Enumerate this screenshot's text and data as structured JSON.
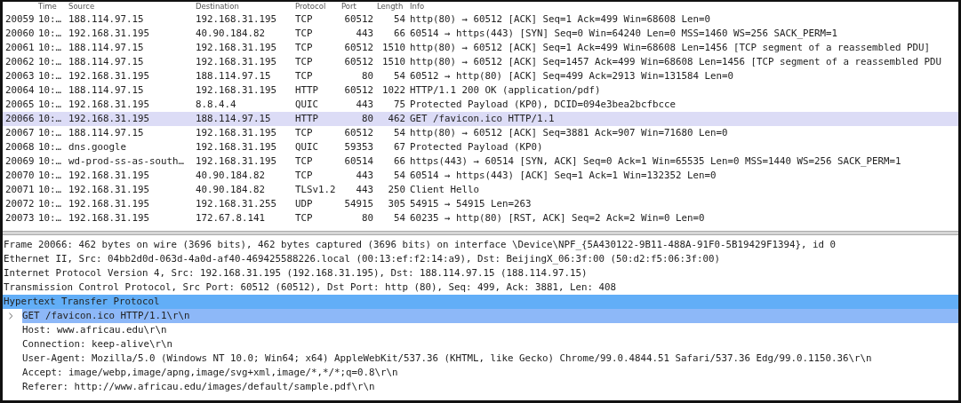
{
  "packet_list": {
    "columns": [
      "Time",
      "Source",
      "Destination",
      "Protocol",
      "Port",
      "Length",
      "Info"
    ],
    "rows": [
      {
        "no": "20059",
        "time": "10:…",
        "source": "188.114.97.15",
        "destination": "192.168.31.195",
        "protocol": "TCP",
        "port": "60512",
        "length": "54",
        "info": "http(80) → 60512 [ACK] Seq=1 Ack=499 Win=68608 Len=0",
        "selected": false
      },
      {
        "no": "20060",
        "time": "10:…",
        "source": "192.168.31.195",
        "destination": "40.90.184.82",
        "protocol": "TCP",
        "port": "443",
        "length": "66",
        "info": "60514 → https(443) [SYN] Seq=0 Win=64240 Len=0 MSS=1460 WS=256 SACK_PERM=1",
        "selected": false
      },
      {
        "no": "20061",
        "time": "10:…",
        "source": "188.114.97.15",
        "destination": "192.168.31.195",
        "protocol": "TCP",
        "port": "60512",
        "length": "1510",
        "info": "http(80) → 60512 [ACK] Seq=1 Ack=499 Win=68608 Len=1456 [TCP segment of a reassembled PDU]",
        "selected": false
      },
      {
        "no": "20062",
        "time": "10:…",
        "source": "188.114.97.15",
        "destination": "192.168.31.195",
        "protocol": "TCP",
        "port": "60512",
        "length": "1510",
        "info": "http(80) → 60512 [ACK] Seq=1457 Ack=499 Win=68608 Len=1456 [TCP segment of a reassembled PDU",
        "selected": false
      },
      {
        "no": "20063",
        "time": "10:…",
        "source": "192.168.31.195",
        "destination": "188.114.97.15",
        "protocol": "TCP",
        "port": "80",
        "length": "54",
        "info": "60512 → http(80) [ACK] Seq=499 Ack=2913 Win=131584 Len=0",
        "selected": false
      },
      {
        "no": "20064",
        "time": "10:…",
        "source": "188.114.97.15",
        "destination": "192.168.31.195",
        "protocol": "HTTP",
        "port": "60512",
        "length": "1022",
        "info": "HTTP/1.1 200 OK  (application/pdf)",
        "selected": false
      },
      {
        "no": "20065",
        "time": "10:…",
        "source": "192.168.31.195",
        "destination": "8.8.4.4",
        "protocol": "QUIC",
        "port": "443",
        "length": "75",
        "info": "Protected Payload (KP0), DCID=094e3bea2bcfbcce",
        "selected": false
      },
      {
        "no": "20066",
        "time": "10:…",
        "source": "192.168.31.195",
        "destination": "188.114.97.15",
        "protocol": "HTTP",
        "port": "80",
        "length": "462",
        "info": "GET /favicon.ico HTTP/1.1",
        "selected": true
      },
      {
        "no": "20067",
        "time": "10:…",
        "source": "188.114.97.15",
        "destination": "192.168.31.195",
        "protocol": "TCP",
        "port": "60512",
        "length": "54",
        "info": "http(80) → 60512 [ACK] Seq=3881 Ack=907 Win=71680 Len=0",
        "selected": false
      },
      {
        "no": "20068",
        "time": "10:…",
        "source": "dns.google",
        "destination": "192.168.31.195",
        "protocol": "QUIC",
        "port": "59353",
        "length": "67",
        "info": "Protected Payload (KP0)",
        "selected": false
      },
      {
        "no": "20069",
        "time": "10:…",
        "source": "wd-prod-ss-as-south…",
        "destination": "192.168.31.195",
        "protocol": "TCP",
        "port": "60514",
        "length": "66",
        "info": "https(443) → 60514 [SYN, ACK] Seq=0 Ack=1 Win=65535 Len=0 MSS=1440 WS=256 SACK_PERM=1",
        "selected": false
      },
      {
        "no": "20070",
        "time": "10:…",
        "source": "192.168.31.195",
        "destination": "40.90.184.82",
        "protocol": "TCP",
        "port": "443",
        "length": "54",
        "info": "60514 → https(443) [ACK] Seq=1 Ack=1 Win=132352 Len=0",
        "selected": false
      },
      {
        "no": "20071",
        "time": "10:…",
        "source": "192.168.31.195",
        "destination": "40.90.184.82",
        "protocol": "TLSv1.2",
        "port": "443",
        "length": "250",
        "info": "Client Hello",
        "selected": false
      },
      {
        "no": "20072",
        "time": "10:…",
        "source": "192.168.31.195",
        "destination": "192.168.31.255",
        "protocol": "UDP",
        "port": "54915",
        "length": "305",
        "info": "54915 → 54915 Len=263",
        "selected": false
      },
      {
        "no": "20073",
        "time": "10:…",
        "source": "192.168.31.195",
        "destination": "172.67.8.141",
        "protocol": "TCP",
        "port": "80",
        "length": "54",
        "info": "60235 → http(80) [RST, ACK] Seq=2 Ack=2 Win=0 Len=0",
        "selected": false
      }
    ]
  },
  "details": [
    {
      "text": "Frame 20066: 462 bytes on wire (3696 bits), 462 bytes captured (3696 bits) on interface \\Device\\NPF_{5A430122-9B11-488A-91F0-5B19429F1394}, id 0",
      "selected": false
    },
    {
      "text": "Ethernet II, Src: 04bb2d0d-063d-4a0d-af40-469425588226.local (00:13:ef:f2:14:a9), Dst: BeijingX_06:3f:00 (50:d2:f5:06:3f:00)",
      "selected": false
    },
    {
      "text": "Internet Protocol Version 4, Src: 192.168.31.195 (192.168.31.195), Dst: 188.114.97.15 (188.114.97.15)",
      "selected": false
    },
    {
      "text": "Transmission Control Protocol, Src Port: 60512 (60512), Dst Port: http (80), Seq: 499, Ack: 3881, Len: 408",
      "selected": false
    },
    {
      "text": "Hypertext Transfer Protocol",
      "selected": true,
      "children": [
        {
          "text": "GET /favicon.ico HTTP/1.1\\r\\n",
          "selected": true,
          "expanded": false
        },
        {
          "text": "Host: www.africau.edu\\r\\n",
          "selected": false
        },
        {
          "text": "Connection: keep-alive\\r\\n",
          "selected": false
        },
        {
          "text": "User-Agent: Mozilla/5.0 (Windows NT 10.0; Win64; x64) AppleWebKit/537.36 (KHTML, like Gecko) Chrome/99.0.4844.51 Safari/537.36 Edg/99.0.1150.36\\r\\n",
          "selected": false
        },
        {
          "text": "Accept: image/webp,image/apng,image/svg+xml,image/*,*/*;q=0.8\\r\\n",
          "selected": false
        },
        {
          "text": "Referer: http://www.africau.edu/images/default/sample.pdf\\r\\n",
          "selected": false
        }
      ]
    }
  ]
}
